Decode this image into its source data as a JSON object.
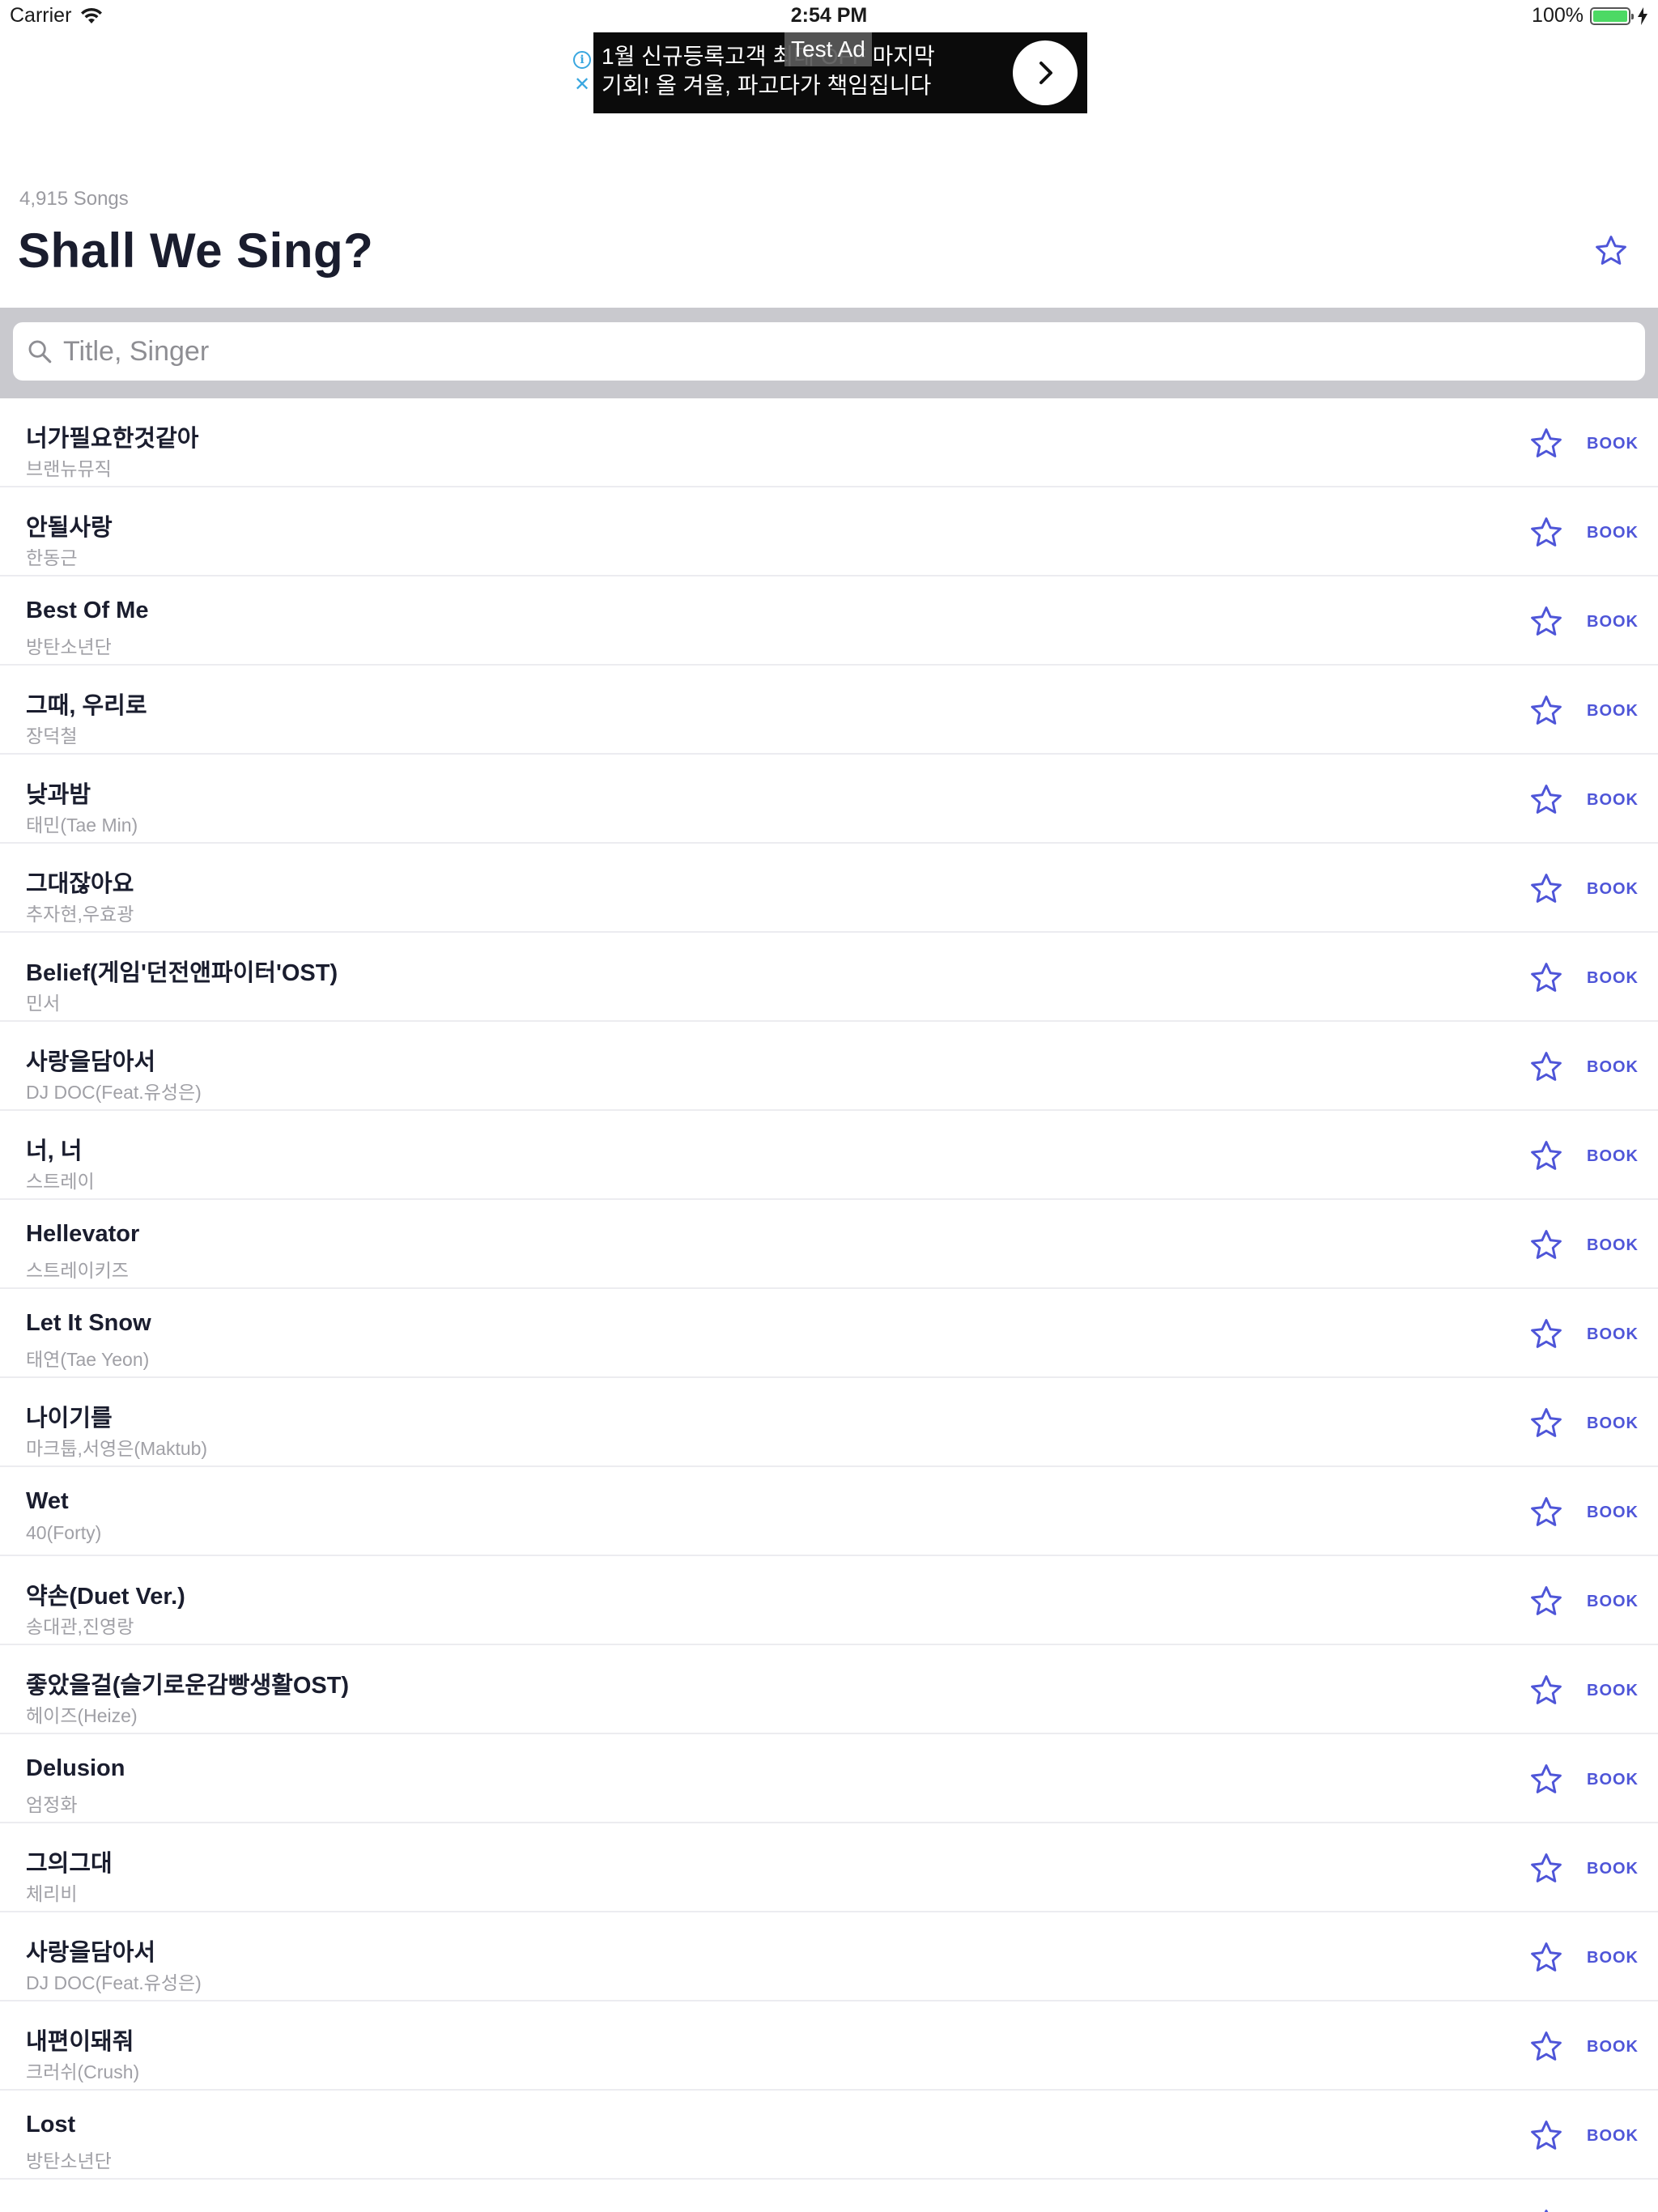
{
  "status_bar": {
    "carrier": "Carrier",
    "time": "2:54 PM",
    "battery_percent": "100%",
    "battery_level": 1.0,
    "battery_color": "#4cd964",
    "icons": [
      "wifi-icon",
      "battery-icon",
      "charging-bolt-icon"
    ]
  },
  "ad": {
    "line1": "1월 신규등록고객 최대 OFF 마지막",
    "line2": "기회! 올 겨울, 파고다가 책임집니다",
    "test_label": "Test Ad",
    "info_glyph": "i",
    "close_glyph": "✕"
  },
  "header": {
    "songs_count": "4,915 Songs",
    "title": "Shall We Sing?"
  },
  "search": {
    "placeholder": "Title, Singer",
    "value": ""
  },
  "colors": {
    "accent": "#4e55d8",
    "title_text": "#1a1d2e",
    "artist_text": "#a0a0a6",
    "search_bar_bg": "#c9c9ce"
  },
  "book_label": "BOOK",
  "songs": [
    {
      "title": "너가필요한것같아",
      "artist": "브랜뉴뮤직"
    },
    {
      "title": "안될사랑",
      "artist": "한동근"
    },
    {
      "title": "Best Of Me",
      "artist": "방탄소년단"
    },
    {
      "title": "그때, 우리로",
      "artist": "장덕철"
    },
    {
      "title": "낮과밤",
      "artist": "태민(Tae Min)"
    },
    {
      "title": "그대잖아요",
      "artist": "추자현,우효광"
    },
    {
      "title": "Belief(게임'던전앤파이터'OST)",
      "artist": "민서"
    },
    {
      "title": "사랑을담아서",
      "artist": "DJ DOC(Feat.유성은)"
    },
    {
      "title": "너, 너",
      "artist": "스트레이"
    },
    {
      "title": "Hellevator",
      "artist": "스트레이키즈"
    },
    {
      "title": "Let It Snow",
      "artist": "태연(Tae Yeon)"
    },
    {
      "title": "나이기를",
      "artist": "마크툽,서영은(Maktub)"
    },
    {
      "title": "Wet",
      "artist": "40(Forty)"
    },
    {
      "title": "약손(Duet Ver.)",
      "artist": "송대관,진영랑"
    },
    {
      "title": "좋았을걸(슬기로운감빵생활OST)",
      "artist": "헤이즈(Heize)"
    },
    {
      "title": "Delusion",
      "artist": "엄정화"
    },
    {
      "title": "그의그대",
      "artist": "체리비"
    },
    {
      "title": "사랑을담아서",
      "artist": "DJ DOC(Feat.유성은)"
    },
    {
      "title": "내편이돼줘",
      "artist": "크러쉬(Crush)"
    },
    {
      "title": "Lost",
      "artist": "방탄소년단"
    },
    {
      "title": "",
      "artist": ""
    }
  ]
}
